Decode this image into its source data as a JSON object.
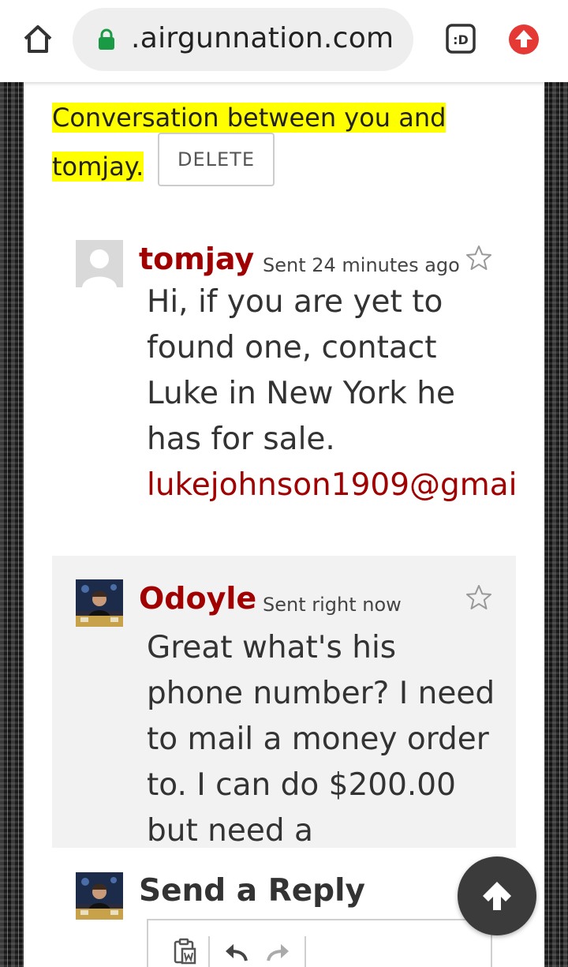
{
  "browser": {
    "url": ".airgunnation.com",
    "tab_badge": ":D"
  },
  "conversation": {
    "title": "Conversation between you and tomjay.",
    "delete_label": "DELETE"
  },
  "messages": [
    {
      "sender": "tomjay",
      "sent": "Sent 24 minutes ago",
      "body": " Hi, if you are yet to found one, contact Luke in New York he has for sale.",
      "link": "lukejohnson1909@gmai"
    },
    {
      "sender": "Odoyle",
      "sent": "Sent right now",
      "body": "Great what's his phone number? I need to mail a money order to. I can do $200.00 but need a"
    }
  ],
  "reply": {
    "title": "Send a Reply"
  },
  "colors": {
    "accent": "#a00000",
    "highlight": "#ffff00",
    "secure": "#1a9a44",
    "upload": "#e53935"
  },
  "icons": [
    "home-icon",
    "lock-icon",
    "tab-switcher-icon",
    "upload-icon",
    "star-icon",
    "paste-icon",
    "undo-icon",
    "redo-icon",
    "arrow-up-icon"
  ]
}
